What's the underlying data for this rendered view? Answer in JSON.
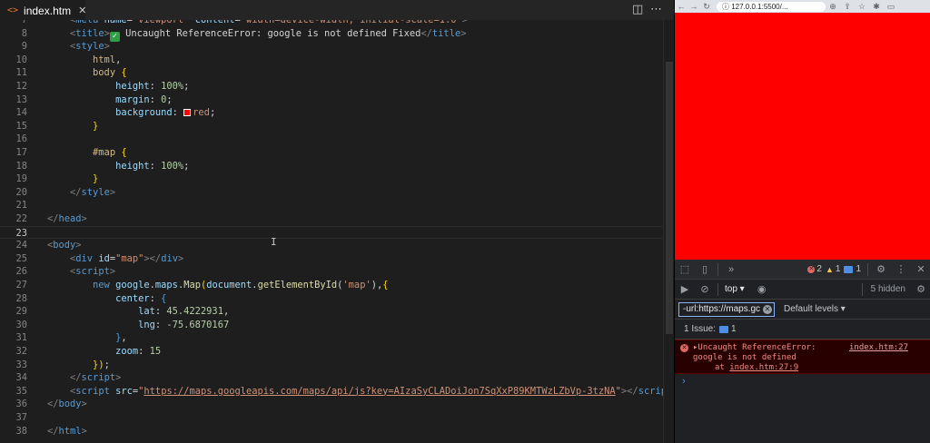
{
  "editor": {
    "tab_label": "index.htm",
    "tab_icon": "<>",
    "close_glyph": "✕",
    "split_icon": "◫",
    "more_icon": "⋯"
  },
  "code_lines": [
    {
      "n": "7",
      "html": "    <span class='tag'>&lt;</span><span class='tn'>meta</span> <span class='an'>name</span>=<span class='st'>\"viewport\"</span> <span class='an'>content</span>=<span class='st'>\"width=device-width, initial-scale=1.0\"</span><span class='tag'>&gt;</span>"
    },
    {
      "n": "8",
      "html": "    <span class='tag'>&lt;</span><span class='tn'>title</span><span class='tag'>&gt;</span><span class='check'>✓</span> Uncaught ReferenceError: google is not defined Fixed<span class='tag'>&lt;/</span><span class='tn'>title</span><span class='tag'>&gt;</span>"
    },
    {
      "n": "9",
      "html": "    <span class='tag'>&lt;</span><span class='tn'>style</span><span class='tag'>&gt;</span>"
    },
    {
      "n": "10",
      "html": "        <span class='cs'>html</span>,"
    },
    {
      "n": "11",
      "html": "        <span class='cs'>body</span> <span class='br'>{</span>"
    },
    {
      "n": "12",
      "html": "            <span class='pr'>height</span>: <span class='nm'>100%</span>;"
    },
    {
      "n": "13",
      "html": "            <span class='pr'>margin</span>: <span class='nm'>0</span>;"
    },
    {
      "n": "14",
      "html": "            <span class='pr'>background</span>: <span class='swatch'></span><span class='st'>red</span>;"
    },
    {
      "n": "15",
      "html": "        <span class='br'>}</span>"
    },
    {
      "n": "16",
      "html": ""
    },
    {
      "n": "17",
      "html": "        <span class='cs'>#map</span> <span class='br'>{</span>"
    },
    {
      "n": "18",
      "html": "            <span class='pr'>height</span>: <span class='nm'>100%</span>;"
    },
    {
      "n": "19",
      "html": "        <span class='br'>}</span>"
    },
    {
      "n": "20",
      "html": "    <span class='tag'>&lt;/</span><span class='tn'>style</span><span class='tag'>&gt;</span>"
    },
    {
      "n": "21",
      "html": ""
    },
    {
      "n": "22",
      "html": "<span class='tag'>&lt;/</span><span class='tn'>head</span><span class='tag'>&gt;</span>"
    },
    {
      "n": "23",
      "html": "",
      "current": true
    },
    {
      "n": "24",
      "html": "<span class='tag'>&lt;</span><span class='tn'>body</span><span class='tag'>&gt;</span>"
    },
    {
      "n": "25",
      "html": "    <span class='tag'>&lt;</span><span class='tn'>div</span> <span class='an'>id</span>=<span class='st'>\"map\"</span><span class='tag'>&gt;&lt;/</span><span class='tn'>div</span><span class='tag'>&gt;</span>"
    },
    {
      "n": "26",
      "html": "    <span class='tag'>&lt;</span><span class='tn'>script</span><span class='tag'>&gt;</span>"
    },
    {
      "n": "27",
      "html": "        <span class='kw'>new</span> <span class='an'>google</span>.<span class='an'>maps</span>.<span class='fn'>Map</span><span class='br'>(</span><span class='an'>document</span>.<span class='fn'>getElementById</span>(<span class='st'>'map'</span>),<span class='br'>{</span>"
    },
    {
      "n": "28",
      "html": "            <span class='an'>center</span>: <span class='kw'>{</span>"
    },
    {
      "n": "29",
      "html": "                <span class='an'>lat</span>: <span class='nm'>45.4222931</span>,"
    },
    {
      "n": "30",
      "html": "                <span class='an'>lng</span>: <span class='nm'>-75.6870167</span>"
    },
    {
      "n": "31",
      "html": "            <span class='kw'>}</span>,"
    },
    {
      "n": "32",
      "html": "            <span class='an'>zoom</span>: <span class='nm'>15</span>"
    },
    {
      "n": "33",
      "html": "        <span class='br'>}</span><span class='br'>)</span>;"
    },
    {
      "n": "34",
      "html": "    <span class='tag'>&lt;/</span><span class='tn'>script</span><span class='tag'>&gt;</span>"
    },
    {
      "n": "35",
      "html": "    <span class='tag'>&lt;</span><span class='tn'>script</span> <span class='an'>src</span>=<span class='st'>\"</span><span class='url'>https://maps.googleapis.com/maps/api/js?key=AIzaSyCLADoiJon7SqXxP89KMTWzLZbVp-3tzNA</span><span class='st'>\"</span><span class='tag'>&gt;&lt;/</span><span class='tn'>script</span><span class='tag'>&gt;</span>"
    },
    {
      "n": "36",
      "html": "<span class='tag'>&lt;/</span><span class='tn'>body</span><span class='tag'>&gt;</span>"
    },
    {
      "n": "37",
      "html": ""
    },
    {
      "n": "38",
      "html": "<span class='tag'>&lt;/</span><span class='tn'>html</span><span class='tag'>&gt;</span>"
    }
  ],
  "browser": {
    "back_icon": "←",
    "forward_icon": "→",
    "reload_icon": "↻",
    "info_icon": "ⓘ",
    "address": "127.0.0.1:5500/...",
    "zoom_icon": "⊕",
    "share_icon": "⇪",
    "star_icon": "☆",
    "extensions_icon": "✱",
    "sidepanel_icon": "▭",
    "page_background": "#ff0000"
  },
  "devtools": {
    "inspect_icon": "⬚",
    "device_icon": "▯",
    "more_tabs": "»",
    "error_count": "2",
    "warning_count": "1",
    "message_count": "1",
    "settings_icon": "⚙",
    "menu_icon": "⋮",
    "close_icon": "✕",
    "sidebar_icon": "▶",
    "clear_icon": "⊘",
    "context": "top ▾",
    "eye_icon": "◉",
    "hidden_count": "5 hidden",
    "filter_value": "-url:https://maps.gc",
    "filter_clear": "✕",
    "levels": "Default levels ▾",
    "issues_label": "1 Issue:",
    "issues_count": "1",
    "error_line1": "▸Uncaught ReferenceError:",
    "error_line2": "google is not defined",
    "error_line3_prefix": "at ",
    "error_line3_link": "index.htm:27:9",
    "error_source": "index.htm:27",
    "prompt": "›"
  }
}
